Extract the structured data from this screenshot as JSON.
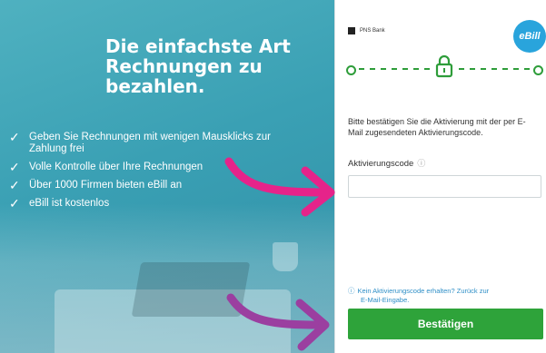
{
  "promo": {
    "heading": "Die einfachste Art Rechnungen zu bezahlen.",
    "benefits": [
      "Geben Sie Rechnungen mit wenigen Mausklicks zur Zahlung frei",
      "Volle Kontrolle über Ihre Rechnungen",
      "Über 1000 Firmen bieten eBill an",
      "eBill ist kostenlos"
    ]
  },
  "form": {
    "bank_name": "PNS Bank",
    "logo_text": "eBill",
    "instruction": "Bitte bestätigen Sie die Aktivierung mit der per E-Mail zugesendeten Aktivierungscode.",
    "code_label": "Aktivierungscode",
    "code_value": "",
    "help_line1": "Kein Aktivierungscode erhalten? Zurück zur",
    "help_line2": "E-Mail-Eingabe.",
    "confirm_label": "Bestätigen"
  },
  "icons": {
    "check": "check-icon",
    "info": "info-icon",
    "lock": "lock-icon",
    "arrow": "arrow-icon"
  },
  "colors": {
    "accent_green": "#2ea33a",
    "promo_teal": "#3aa0b4",
    "arrow_pink": "#e6238a",
    "arrow_purple": "#9b3fa0",
    "link_blue": "#2f8fc7",
    "ebill_blue": "#29a4dc"
  }
}
